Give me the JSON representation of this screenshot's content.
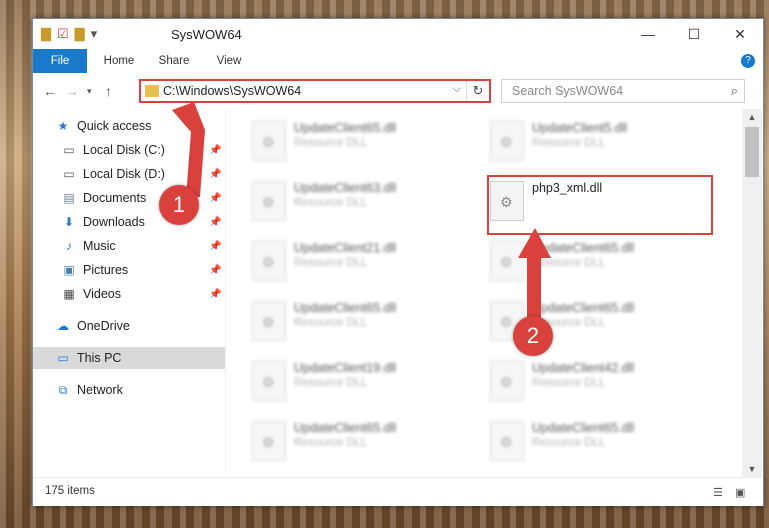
{
  "window": {
    "title": "SysWOW64"
  },
  "titlebar": {
    "minimize": "—",
    "maximize": "☐",
    "close": "✕"
  },
  "ribbon": {
    "tabs": [
      "File",
      "Home",
      "Share",
      "View"
    ],
    "help": "?"
  },
  "address": {
    "path": "C:\\Windows\\SysWOW64"
  },
  "search": {
    "placeholder": "Search SysWOW64"
  },
  "sidebar": {
    "items": [
      {
        "label": "Quick access",
        "icon": "star-icon"
      },
      {
        "label": "Local Disk (C:)",
        "icon": "drive-icon"
      },
      {
        "label": "Local Disk (D:)",
        "icon": "drive-icon"
      },
      {
        "label": "Documents",
        "icon": "documents-icon"
      },
      {
        "label": "Downloads",
        "icon": "download-icon"
      },
      {
        "label": "Music",
        "icon": "music-icon"
      },
      {
        "label": "Pictures",
        "icon": "pictures-icon"
      },
      {
        "label": "Videos",
        "icon": "videos-icon"
      },
      {
        "label": "OneDrive",
        "icon": "cloud-icon"
      },
      {
        "label": "This PC",
        "icon": "computer-icon"
      },
      {
        "label": "Network",
        "icon": "network-icon"
      }
    ]
  },
  "files": {
    "left": [
      {
        "name": "UpdateClient65.dll",
        "type": "Resource DLL"
      },
      {
        "name": "UpdateClient63.dll",
        "type": "Resource DLL"
      },
      {
        "name": "UpdateClient21.dll",
        "type": "Resource DLL"
      },
      {
        "name": "UpdateClient65.dll",
        "type": "Resource DLL"
      },
      {
        "name": "UpdateClient19.dll",
        "type": "Resource DLL"
      },
      {
        "name": "UpdateClient65.dll",
        "type": "Resource DLL"
      }
    ],
    "right": [
      {
        "name": "UpdateClient5.dll",
        "type": "Resource DLL"
      },
      {
        "name": "php3_xml.dll",
        "type": ""
      },
      {
        "name": "UpdateClient65.dll",
        "type": "Resource DLL"
      },
      {
        "name": "UpdateClient65.dll",
        "type": "Resource DLL"
      },
      {
        "name": "UpdateClient42.dll",
        "type": "Resource DLL"
      },
      {
        "name": "UpdateClient65.dll",
        "type": "Resource DLL"
      }
    ]
  },
  "annotations": {
    "badge1": "1",
    "badge2": "2"
  },
  "status": {
    "item_count": "175 items"
  },
  "colors": {
    "accent": "#1979ca",
    "highlight": "#d9413d"
  }
}
